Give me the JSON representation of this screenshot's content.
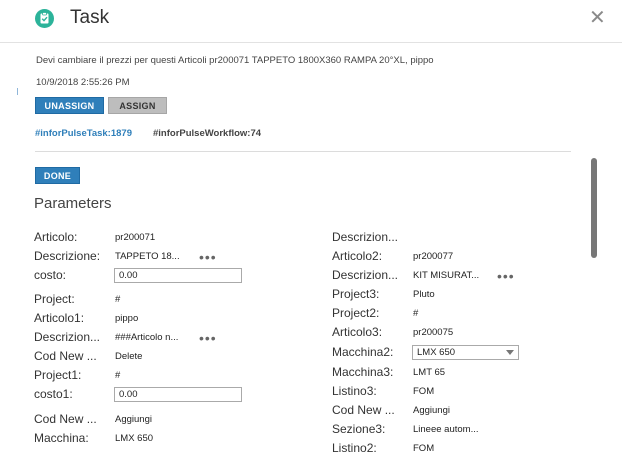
{
  "header": {
    "title": "Task",
    "close_icon": "close-icon",
    "app_icon": "clipboard-check-icon",
    "accent": "#2cb39a"
  },
  "task": {
    "message": "Devi cambiare il prezzi per questi Articoli pr200071 TAPPETO 1800X360 RAMPA 20°XL, pippo",
    "date": "10/9/2018 2:55:26 PM"
  },
  "buttons": {
    "unassign": "UNASSIGN",
    "assign": "ASSIGN",
    "done": "DONE"
  },
  "tags": [
    "#inforPulseTask:1879",
    "#inforPulseWorkflow:74"
  ],
  "parameters": {
    "title": "Parameters",
    "left": [
      {
        "label": "Articolo:",
        "value": "pr200071"
      },
      {
        "label": "Descrizione:",
        "value": "TAPPETO 18...",
        "more": "•••"
      },
      {
        "label": "costo:",
        "input": "0.00"
      },
      {
        "label": "Project:",
        "value": "#"
      },
      {
        "label": "Articolo1:",
        "value": "pippo"
      },
      {
        "label": "Descrizion...",
        "value": "###Articolo n...",
        "more": "•••"
      },
      {
        "label": "Cod New ...",
        "value": "Delete"
      },
      {
        "label": "Project1:",
        "value": "#"
      },
      {
        "label": "costo1:",
        "input": "0.00"
      },
      {
        "label": "Cod New ...",
        "value": "Aggiungi"
      },
      {
        "label": "Macchina:",
        "value": "LMX 650"
      }
    ],
    "right": [
      {
        "label": "Descrizion...",
        "value": ""
      },
      {
        "label": "Articolo2:",
        "value": "pr200077"
      },
      {
        "label": "Descrizion...",
        "value": "KIT MISURAT...",
        "more": "•••"
      },
      {
        "label": "Project3:",
        "value": "Pluto"
      },
      {
        "label": "Project2:",
        "value": "#"
      },
      {
        "label": "Articolo3:",
        "value": "pr200075"
      },
      {
        "label": "Macchina2:",
        "select": "LMX 650"
      },
      {
        "label": "Macchina3:",
        "value": "LMT 65"
      },
      {
        "label": "Listino3:",
        "value": "FOM"
      },
      {
        "label": "Cod New ...",
        "value": "Aggiungi"
      },
      {
        "label": "Sezione3:",
        "value": "Lineee autom..."
      },
      {
        "label": "Listino2:",
        "value": "FOM"
      }
    ]
  }
}
